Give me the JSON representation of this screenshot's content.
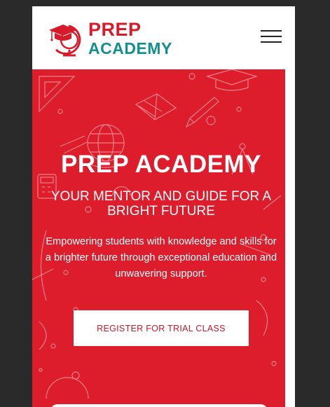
{
  "brand": {
    "name_line1": "PREP",
    "name_line2": "ACADEMY",
    "logo_icon": "graduation-cap-globe-icon",
    "primary_color": "#d81b2a",
    "secondary_color": "#11908e"
  },
  "header": {
    "menu_icon": "hamburger-menu-icon"
  },
  "hero": {
    "title": "PREP ACADEMY",
    "subtitle": "YOUR MENTOR AND GUIDE FOR A BRIGHT FUTURE",
    "description": "Empowering students with knowledge and skills for a brighter future through exceptional education and unwavering support.",
    "cta_label": "REGISTER FOR TRIAL CLASS",
    "background_color": "#dd1c2c",
    "decor_icons": [
      "book-icon",
      "globe-icon",
      "pencil-icon",
      "compass-icon",
      "calculator-icon",
      "ruler-icon",
      "graduation-cap-icon"
    ]
  }
}
